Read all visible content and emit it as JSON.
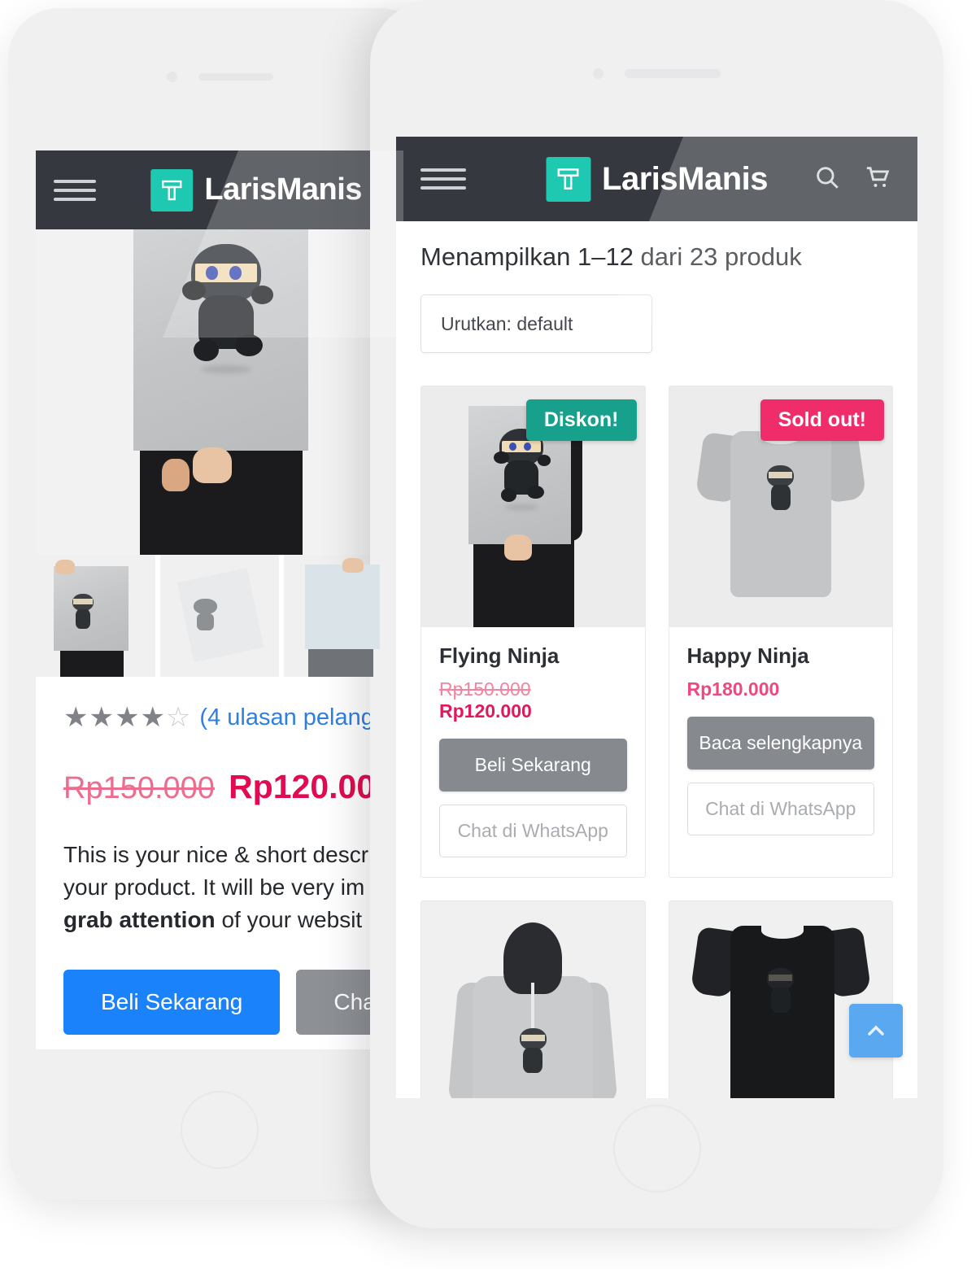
{
  "header": {
    "brand_name": "LarisManis",
    "menu_icon": "hamburger-menu-icon",
    "logo_icon": "larismanis-t-logo-icon",
    "search_icon": "search-icon",
    "cart_icon": "shopping-cart-icon"
  },
  "shop": {
    "result_count": "Menampilkan 1–12 dari 23 produk",
    "sort_label": "Urutkan: default",
    "sort_options": [
      "Urutkan: default"
    ],
    "scroll_top_icon": "chevron-up-icon",
    "products": [
      {
        "name": "Flying Ninja",
        "badge": "Diskon!",
        "badge_type": "sale",
        "badge_color": "#17a08b",
        "price_old": "Rp150.000",
        "price_new": "Rp120.000",
        "primary_button": "Beli Sekarang",
        "secondary_button": "Chat di WhatsApp",
        "image": "person-holding-flying-ninja-poster"
      },
      {
        "name": "Happy Ninja",
        "badge": "Sold out!",
        "badge_type": "soldout",
        "badge_color": "#ef2d6a",
        "price_old": "",
        "price_new": "Rp180.000",
        "primary_button": "Baca selengkapnya",
        "secondary_button": "Chat di WhatsApp",
        "image": "grey-ninja-tshirt"
      },
      {
        "name": "",
        "badge": "",
        "badge_type": "none",
        "price_old": "",
        "price_new": "",
        "primary_button": "",
        "secondary_button": "",
        "image": "grey-ninja-hoodie"
      },
      {
        "name": "",
        "badge": "",
        "badge_type": "none",
        "price_old": "",
        "price_new": "",
        "primary_button": "",
        "secondary_button": "",
        "image": "black-ninja-tshirt"
      }
    ]
  },
  "detail": {
    "hero_image": "person-holding-flying-ninja-poster",
    "thumbnails": [
      "ninja-poster-held-thumbnail",
      "ninja-poster-flat-thumbnail",
      "lightbulb-poster-held-thumbnail"
    ],
    "rating_stars_filled": 4,
    "rating_stars_total": 5,
    "review_link": "(4 ulasan pelangg",
    "price_old": "Rp150.000",
    "price_new": "Rp120.000",
    "description_line1": "This is your nice & short descr",
    "description_line2": "your product. It will be very im",
    "description_line3_bold": "grab attention",
    "description_line3_rest": " of your websit",
    "buy_button": "Beli Sekarang",
    "chat_button": "Cha"
  },
  "colors": {
    "header_bg": "#35393f",
    "logo_teal": "#1fc8b0",
    "sale_badge": "#17a08b",
    "soldout_badge": "#ef2d6a",
    "price_accent": "#e0195c",
    "link_blue": "#2f7fe0",
    "buy_blue": "#1a82fb",
    "scroll_top_blue": "#5aa9f0",
    "phone_body": "#f0f0f1"
  }
}
